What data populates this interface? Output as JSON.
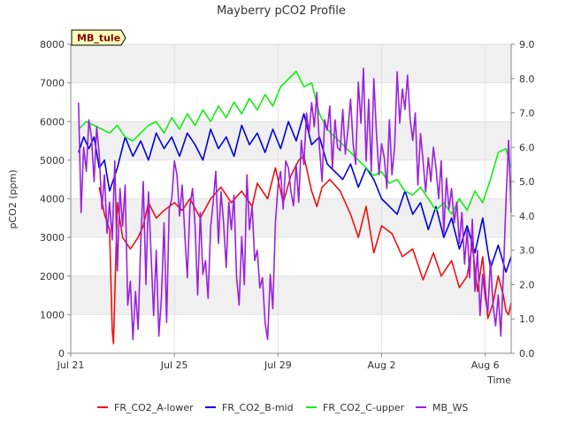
{
  "chart_data": {
    "type": "line",
    "title": "Mayberry pCO2 Profile",
    "xlabel": "Time",
    "ylabel": "pCO2 (ppm)",
    "badge": "MB_tule",
    "x_ticks": [
      "Jul 21",
      "Jul 25",
      "Jul 29",
      "Aug 2",
      "Aug 6"
    ],
    "x_tick_days": [
      0,
      4,
      8,
      12,
      16
    ],
    "xlim_days": [
      0,
      17
    ],
    "ylim": [
      0,
      8000
    ],
    "y_ticks": [
      0,
      1000,
      2000,
      3000,
      4000,
      5000,
      6000,
      7000,
      8000
    ],
    "y2lim": [
      0,
      9
    ],
    "y2_ticks": [
      "0.0",
      "1.0",
      "2.0",
      "3.0",
      "4.0",
      "5.0",
      "6.0",
      "7.0",
      "8.0",
      "9.0"
    ],
    "grid": true,
    "legend_position": "bottom",
    "series": [
      {
        "name": "FR_CO2_A-lower",
        "color": "#ee1111",
        "axis": "left",
        "x": [
          1.1,
          1.3,
          1.5,
          1.6,
          1.65,
          1.8,
          2.0,
          2.3,
          2.6,
          2.8,
          3.0,
          3.3,
          3.6,
          4.0,
          4.3,
          4.6,
          5.0,
          5.4,
          5.8,
          6.2,
          6.6,
          7.0,
          7.2,
          7.6,
          7.9,
          8.2,
          8.5,
          8.8,
          9.0,
          9.3,
          9.5,
          9.7,
          10.0,
          10.4,
          10.8,
          11.1,
          11.4,
          11.7,
          12.0,
          12.4,
          12.8,
          13.2,
          13.6,
          14.0,
          14.3,
          14.7,
          15.0,
          15.3,
          15.5,
          15.7,
          15.9,
          16.1,
          16.3,
          16.5,
          16.7,
          16.8,
          16.9,
          17.0
        ],
        "y": [
          4300,
          3600,
          3200,
          600,
          250,
          3900,
          3000,
          2700,
          3000,
          3300,
          3900,
          3500,
          3700,
          3900,
          3700,
          4000,
          3500,
          4000,
          4300,
          3900,
          4200,
          3800,
          4400,
          4000,
          4800,
          3900,
          4600,
          5000,
          5100,
          4200,
          3800,
          4300,
          4500,
          4200,
          3600,
          3000,
          3800,
          2600,
          3300,
          3100,
          2500,
          2700,
          1900,
          2600,
          2000,
          2400,
          1700,
          2000,
          2800,
          1600,
          2500,
          900,
          1300,
          2000,
          1500,
          1100,
          1000,
          1300
        ]
      },
      {
        "name": "FR_CO2_B-mid",
        "color": "#0000dd",
        "axis": "left",
        "x": [
          0.3,
          0.5,
          0.7,
          0.9,
          1.1,
          1.3,
          1.5,
          1.8,
          2.1,
          2.4,
          2.7,
          3.0,
          3.3,
          3.6,
          3.9,
          4.2,
          4.5,
          4.8,
          5.1,
          5.4,
          5.7,
          6.0,
          6.3,
          6.6,
          6.9,
          7.2,
          7.5,
          7.8,
          8.1,
          8.4,
          8.7,
          9.0,
          9.3,
          9.6,
          9.9,
          10.2,
          10.5,
          10.8,
          11.1,
          11.4,
          11.7,
          12.0,
          12.3,
          12.6,
          12.9,
          13.2,
          13.5,
          13.8,
          14.1,
          14.4,
          14.7,
          15.0,
          15.3,
          15.6,
          15.9,
          16.2,
          16.5,
          16.8,
          17.0
        ],
        "y": [
          5200,
          5600,
          5300,
          5600,
          4800,
          5000,
          4200,
          4800,
          5600,
          5100,
          5500,
          5000,
          5700,
          5300,
          5600,
          5100,
          5700,
          5400,
          5000,
          5800,
          5300,
          5600,
          5100,
          5900,
          5400,
          5700,
          5200,
          5800,
          5300,
          6000,
          5500,
          6200,
          5400,
          5600,
          4900,
          4700,
          4500,
          4900,
          4300,
          4800,
          4500,
          4000,
          3800,
          3600,
          4200,
          3600,
          3900,
          3200,
          3800,
          3000,
          3500,
          2700,
          3300,
          2600,
          3500,
          2200,
          2800,
          2100,
          2500
        ]
      },
      {
        "name": "FR_CO2_C-upper",
        "color": "#11ee11",
        "axis": "left",
        "x": [
          0.3,
          0.6,
          0.9,
          1.2,
          1.5,
          1.8,
          2.1,
          2.4,
          2.7,
          3.0,
          3.3,
          3.6,
          3.9,
          4.2,
          4.5,
          4.8,
          5.1,
          5.4,
          5.7,
          6.0,
          6.3,
          6.6,
          6.9,
          7.2,
          7.5,
          7.8,
          8.1,
          8.4,
          8.7,
          9.0,
          9.3,
          9.6,
          9.9,
          10.2,
          10.5,
          10.8,
          11.1,
          11.4,
          11.7,
          12.0,
          12.3,
          12.6,
          12.9,
          13.2,
          13.5,
          13.8,
          14.1,
          14.4,
          14.7,
          15.0,
          15.3,
          15.6,
          15.9,
          16.2,
          16.5,
          16.8,
          17.0
        ],
        "y": [
          5800,
          6000,
          5900,
          5800,
          5700,
          5900,
          5600,
          5500,
          5700,
          5900,
          6000,
          5700,
          6100,
          5800,
          6200,
          5900,
          6300,
          6000,
          6400,
          6100,
          6500,
          6200,
          6600,
          6300,
          6700,
          6400,
          6900,
          7100,
          7300,
          6900,
          7000,
          6200,
          5800,
          5600,
          5400,
          5200,
          5000,
          4800,
          4600,
          4700,
          4400,
          4500,
          4200,
          4100,
          4300,
          4000,
          3700,
          3900,
          3600,
          4000,
          3700,
          4200,
          3900,
          4500,
          5200,
          5300,
          4800
        ]
      },
      {
        "name": "MB_WS",
        "color": "#9922dd",
        "axis": "right",
        "x": [
          0.3,
          0.4,
          0.5,
          0.6,
          0.7,
          0.8,
          0.9,
          1.0,
          1.1,
          1.2,
          1.3,
          1.4,
          1.5,
          1.6,
          1.7,
          1.8,
          1.9,
          2.0,
          2.1,
          2.2,
          2.3,
          2.4,
          2.5,
          2.6,
          2.7,
          2.8,
          2.9,
          3.0,
          3.1,
          3.2,
          3.3,
          3.4,
          3.5,
          3.6,
          3.7,
          3.8,
          3.9,
          4.0,
          4.1,
          4.2,
          4.3,
          4.4,
          4.5,
          4.6,
          4.7,
          4.8,
          4.9,
          5.0,
          5.1,
          5.2,
          5.3,
          5.4,
          5.5,
          5.6,
          5.7,
          5.8,
          5.9,
          6.0,
          6.1,
          6.2,
          6.3,
          6.4,
          6.5,
          6.6,
          6.7,
          6.8,
          6.9,
          7.0,
          7.1,
          7.2,
          7.3,
          7.4,
          7.5,
          7.6,
          7.7,
          7.8,
          7.9,
          8.0,
          8.1,
          8.2,
          8.3,
          8.4,
          8.5,
          8.6,
          8.7,
          8.8,
          8.9,
          9.0,
          9.1,
          9.2,
          9.3,
          9.4,
          9.5,
          9.6,
          9.7,
          9.8,
          9.9,
          10.0,
          10.1,
          10.2,
          10.3,
          10.4,
          10.5,
          10.6,
          10.7,
          10.8,
          10.9,
          11.0,
          11.1,
          11.2,
          11.3,
          11.4,
          11.5,
          11.6,
          11.7,
          11.8,
          11.9,
          12.0,
          12.1,
          12.2,
          12.3,
          12.4,
          12.5,
          12.6,
          12.7,
          12.8,
          12.9,
          13.0,
          13.1,
          13.2,
          13.3,
          13.4,
          13.5,
          13.6,
          13.7,
          13.8,
          13.9,
          14.0,
          14.1,
          14.2,
          14.3,
          14.4,
          14.5,
          14.6,
          14.7,
          14.8,
          14.9,
          15.0,
          15.1,
          15.2,
          15.3,
          15.4,
          15.5,
          15.6,
          15.7,
          15.8,
          15.9,
          16.0,
          16.1,
          16.2,
          16.3,
          16.4,
          16.5,
          16.6,
          16.7,
          16.8,
          16.9,
          17.0
        ],
        "y": [
          7.3,
          4.1,
          6.0,
          5.3,
          6.8,
          6.3,
          5.0,
          6.6,
          5.8,
          4.2,
          5.2,
          3.5,
          4.4,
          3.3,
          5.6,
          2.4,
          4.8,
          3.7,
          4.9,
          1.4,
          2.1,
          0.4,
          1.8,
          0.7,
          3.2,
          5.0,
          2.0,
          4.7,
          2.9,
          1.1,
          3.0,
          0.5,
          1.6,
          3.8,
          0.9,
          4.2,
          4.5,
          5.6,
          5.2,
          4.0,
          4.9,
          3.5,
          2.2,
          4.3,
          4.8,
          3.7,
          1.7,
          4.1,
          2.3,
          2.7,
          1.6,
          3.7,
          4.4,
          5.3,
          3.2,
          4.7,
          3.8,
          2.5,
          4.4,
          3.6,
          4.6,
          2.2,
          1.4,
          3.4,
          2.0,
          5.2,
          3.6,
          4.3,
          2.7,
          3.0,
          1.9,
          2.2,
          0.9,
          0.4,
          2.3,
          1.3,
          3.8,
          4.9,
          5.3,
          4.2,
          5.6,
          5.4,
          4.7,
          4.3,
          5.5,
          4.4,
          6.2,
          5.5,
          7.0,
          6.4,
          7.3,
          6.6,
          7.6,
          6.0,
          5.0,
          6.8,
          6.5,
          7.2,
          5.4,
          6.8,
          6.0,
          5.9,
          7.1,
          5.8,
          6.5,
          7.4,
          6.1,
          5.5,
          7.9,
          6.7,
          8.3,
          5.6,
          7.4,
          5.3,
          8.0,
          6.4,
          5.2,
          6.1,
          5.7,
          4.8,
          6.8,
          5.2,
          6.0,
          8.2,
          6.7,
          7.7,
          7.1,
          8.1,
          6.8,
          6.2,
          7.0,
          4.9,
          6.4,
          5.6,
          4.7,
          5.7,
          5.0,
          6.0,
          5.4,
          4.5,
          5.6,
          3.5,
          5.1,
          4.2,
          4.8,
          3.8,
          4.4,
          3.2,
          4.1,
          2.6,
          3.6,
          2.2,
          3.9,
          1.8,
          3.0,
          1.1,
          2.3,
          1.6,
          1.2,
          2.7,
          1.4,
          0.8,
          1.7,
          0.5,
          2.3,
          4.4,
          6.2,
          4.1
        ]
      }
    ]
  }
}
